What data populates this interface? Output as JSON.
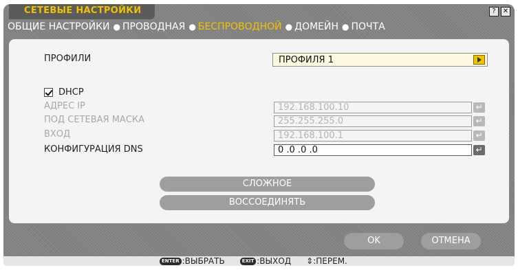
{
  "window": {
    "title": "СЕТЕВЫЕ НАСТРОЙКИ",
    "help_glyph": "?",
    "close_glyph": "✕"
  },
  "tabs": [
    {
      "label": "ОБЩИЕ НАСТРОЙКИ",
      "active": false
    },
    {
      "label": "ПРОВОДНАЯ",
      "active": false
    },
    {
      "label": "БЕСПРОВОДНОЙ",
      "active": true
    },
    {
      "label": "ДОМЕЙН",
      "active": false
    },
    {
      "label": "ПОЧТА",
      "active": false
    }
  ],
  "tab_separator": "●",
  "form": {
    "profiles_label": "ПРОФИЛИ",
    "profile_value": "ПРОФИЛЯ 1",
    "dhcp_label": "DHCP",
    "dhcp_checked": true,
    "ip_label": "АДРЕС IP",
    "ip_value": "192.168.100.10",
    "mask_label": "ПОД СЕТЕВАЯ МАСКА",
    "mask_value": "255.255.255.0",
    "gateway_label": "ВХОД",
    "gateway_value": "192.168.100.1",
    "dns_label": "КОНФИГУРАЦИЯ DNS",
    "dns_value": "0 .0 .0 .0",
    "enter_glyph": "↵"
  },
  "buttons": {
    "advanced": "СЛОЖНОЕ",
    "reconnect": "ВОССОЕДИНЯТЬ",
    "ok": "OK",
    "cancel": "ОТМЕНА"
  },
  "statusbar": {
    "enter_key": "ENTER",
    "enter_action": ":ВЫБРАТЬ",
    "exit_key": "EXIT",
    "exit_action": ":ВЫХОД",
    "move_glyph": "⇕",
    "move_action": ":ПЕРЕМ."
  },
  "colors": {
    "accent": "#f2c000",
    "frame": "#8a8a8a",
    "panel": "#f4f4f4",
    "button": "#9e9e9e"
  }
}
